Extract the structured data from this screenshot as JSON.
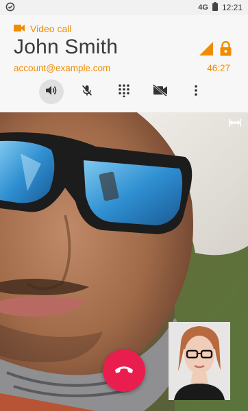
{
  "status_bar": {
    "network": "4G",
    "time": "12:21",
    "left_icon": "check-circle-icon",
    "battery_icon": "battery-icon"
  },
  "call": {
    "type_label": "Video call",
    "caller_name": "John Smith",
    "account": "account@example.com",
    "duration": "46:27",
    "accent_color": "#f08c00"
  },
  "controls": [
    {
      "name": "speaker",
      "icon": "speaker-icon",
      "active": true
    },
    {
      "name": "mute",
      "icon": "microphone-off-icon",
      "active": false
    },
    {
      "name": "dialpad",
      "icon": "dialpad-icon",
      "active": false
    },
    {
      "name": "camera-off",
      "icon": "videocam-off-icon",
      "active": false
    },
    {
      "name": "more",
      "icon": "more-vert-icon",
      "active": false
    }
  ],
  "end_call": {
    "icon": "call-end-icon",
    "color": "#e91e4f"
  }
}
